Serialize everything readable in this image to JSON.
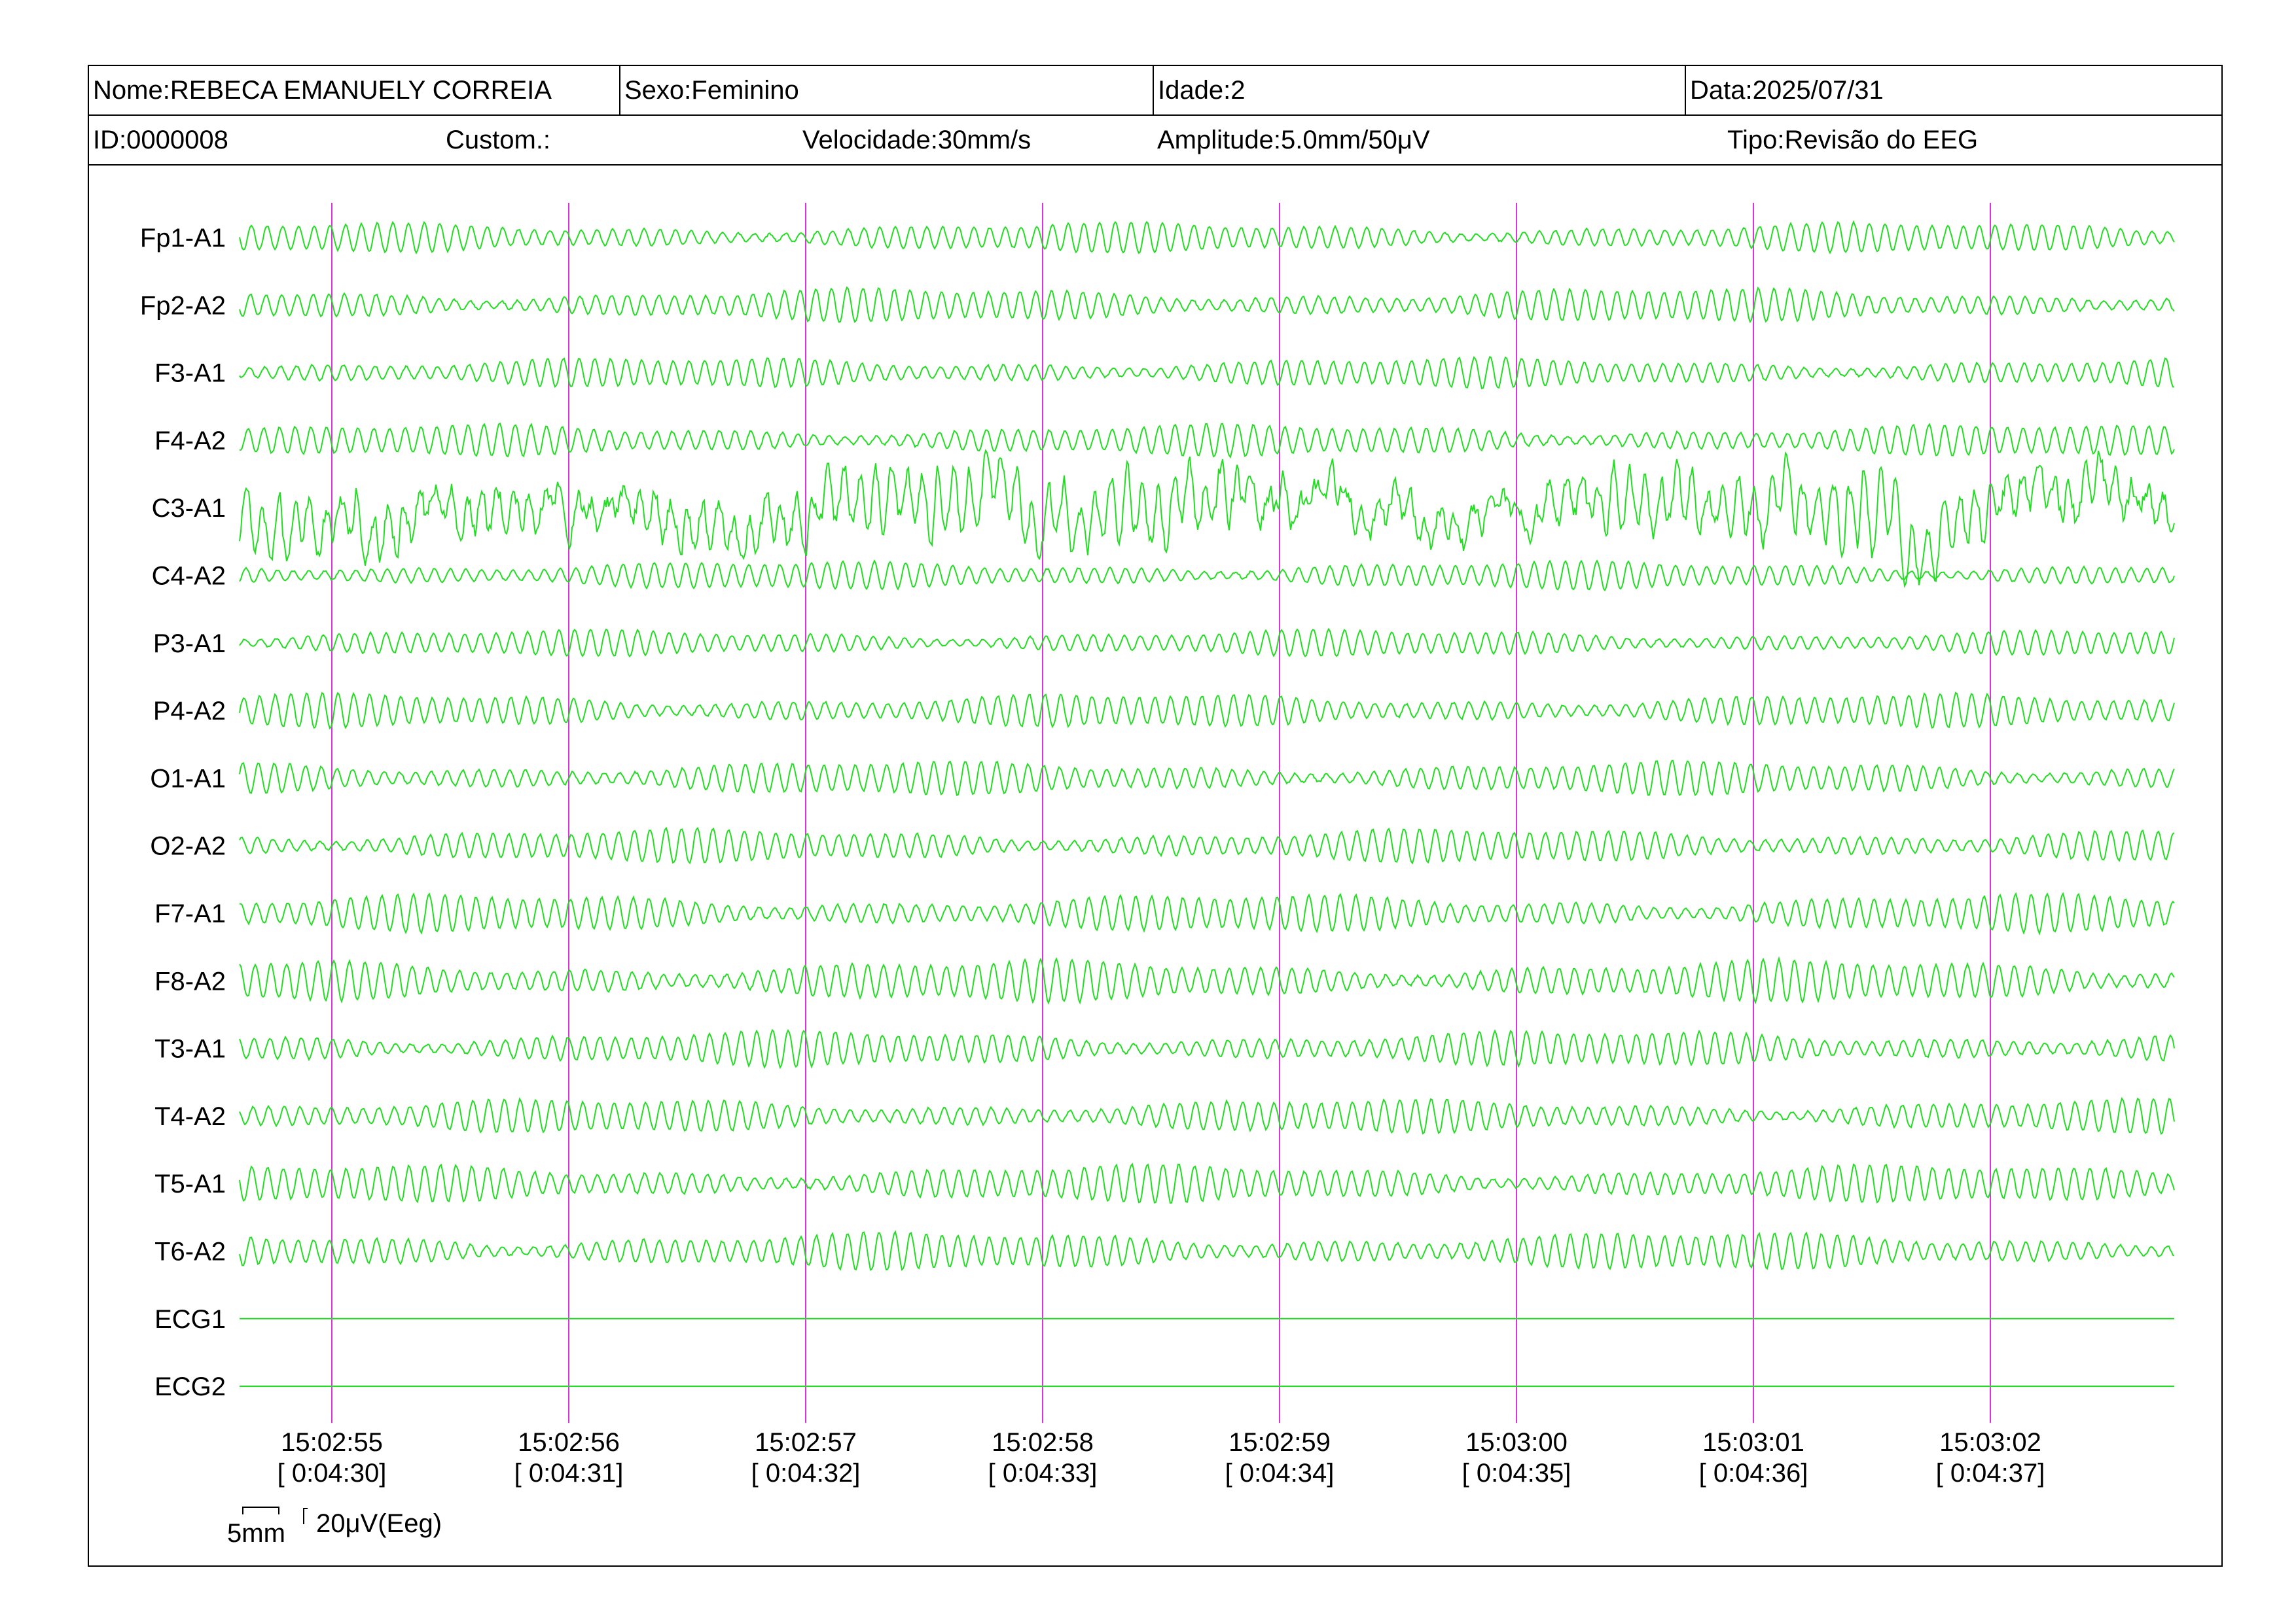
{
  "header": {
    "nome": "Nome:REBECA EMANUELY CORREIA",
    "sexo": "Sexo:Feminino",
    "idade": "Idade:2",
    "data": "Data:2025/07/31",
    "id": "ID:0000008",
    "custom": "Custom.:",
    "velocidade": "Velocidade:30mm/s",
    "amplitude": "Amplitude:5.0mm/50μV",
    "tipo": "Tipo:Revisão do EEG"
  },
  "channels": [
    {
      "name": "Fp1-A1",
      "type": "eeg",
      "amp": 0.8
    },
    {
      "name": "Fp2-A2",
      "type": "eeg",
      "amp": 0.9
    },
    {
      "name": "F3-A1",
      "type": "eeg",
      "amp": 0.8
    },
    {
      "name": "F4-A2",
      "type": "eeg",
      "amp": 0.85
    },
    {
      "name": "C3-A1",
      "type": "eeg",
      "amp": 1.6
    },
    {
      "name": "C4-A2",
      "type": "eeg",
      "amp": 0.75
    },
    {
      "name": "P3-A1",
      "type": "eeg",
      "amp": 0.7
    },
    {
      "name": "P4-A2",
      "type": "eeg",
      "amp": 0.9
    },
    {
      "name": "O1-A1",
      "type": "eeg",
      "amp": 0.9
    },
    {
      "name": "O2-A2",
      "type": "eeg",
      "amp": 0.9
    },
    {
      "name": "F7-A1",
      "type": "eeg",
      "amp": 1.0
    },
    {
      "name": "F8-A2",
      "type": "eeg",
      "amp": 1.1
    },
    {
      "name": "T3-A1",
      "type": "eeg",
      "amp": 0.95
    },
    {
      "name": "T4-A2",
      "type": "eeg",
      "amp": 0.9
    },
    {
      "name": "T5-A1",
      "type": "eeg",
      "amp": 1.0
    },
    {
      "name": "T6-A2",
      "type": "eeg",
      "amp": 1.0
    },
    {
      "name": "ECG1",
      "type": "flat",
      "amp": 0
    },
    {
      "name": "ECG2",
      "type": "flat",
      "amp": 0
    }
  ],
  "time_markers": [
    {
      "clock": "15:02:55",
      "elapsed": "[ 0:04:30]"
    },
    {
      "clock": "15:02:56",
      "elapsed": "[ 0:04:31]"
    },
    {
      "clock": "15:02:57",
      "elapsed": "[ 0:04:32]"
    },
    {
      "clock": "15:02:58",
      "elapsed": "[ 0:04:33]"
    },
    {
      "clock": "15:02:59",
      "elapsed": "[ 0:04:34]"
    },
    {
      "clock": "15:03:00",
      "elapsed": "[ 0:04:35]"
    },
    {
      "clock": "15:03:01",
      "elapsed": "[ 0:04:36]"
    },
    {
      "clock": "15:03:02",
      "elapsed": "[ 0:04:37]"
    }
  ],
  "scale": {
    "time_label": "5mm",
    "amp_label": "20μV(Eeg)"
  },
  "colors": {
    "trace": "#22dd22",
    "marker": "#dd33dd",
    "border": "#000000"
  }
}
